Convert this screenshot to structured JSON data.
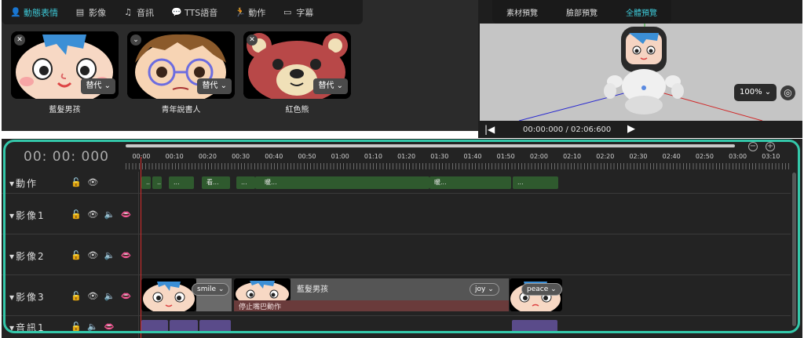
{
  "tabs": [
    {
      "label": "動態表情",
      "icon": "person-icon",
      "active": true
    },
    {
      "label": "影像",
      "icon": "film-icon",
      "active": false
    },
    {
      "label": "音訊",
      "icon": "music-note-icon",
      "active": false
    },
    {
      "label": "TTS語音",
      "icon": "speech-bubble-icon",
      "active": false
    },
    {
      "label": "動作",
      "icon": "running-figure-icon",
      "active": false
    },
    {
      "label": "字幕",
      "icon": "subtitle-icon",
      "active": false
    }
  ],
  "library": {
    "replace_label": "替代",
    "cards": [
      {
        "name": "藍髮男孩"
      },
      {
        "name": "青年說書人"
      },
      {
        "name": "紅色熊"
      }
    ]
  },
  "preview": {
    "tabs": [
      {
        "label": "素材預覽",
        "active": false
      },
      {
        "label": "臉部預覽",
        "active": false
      },
      {
        "label": "全體預覽",
        "active": true
      }
    ],
    "zoom": "100%",
    "timecode": "00:00:000 / 02:06:600"
  },
  "timeline": {
    "current_time": "00: 00: 000",
    "ticks": [
      "00:00",
      "00:10",
      "00:20",
      "00:30",
      "00:40",
      "00:50",
      "01:00",
      "01:10",
      "01:20",
      "01:30",
      "01:40",
      "01:50",
      "02:00",
      "02:10",
      "02:20",
      "02:30",
      "02:40",
      "02:50",
      "03:00",
      "03:10"
    ],
    "tracks": [
      {
        "label": "動作",
        "icons": "🔓 👁"
      },
      {
        "label": "影像1",
        "icons": "🔓 👁 🔈 👄"
      },
      {
        "label": "影像2",
        "icons": "🔓 👁 🔈 👄"
      },
      {
        "label": "影像3",
        "icons": "🔓 👁 🔈 👄"
      },
      {
        "label": "音訊1",
        "icons": "🔓 🔈 👄"
      }
    ],
    "motion_clips": [
      "...",
      "...",
      "...",
      "看...",
      "...",
      "暖...",
      "...",
      "暖..."
    ],
    "clips": {
      "smile": "smile",
      "boy": "藍髮男孩",
      "joy": "joy",
      "stop_mouth": "停止嘴巴動作",
      "peace": "peace"
    }
  }
}
